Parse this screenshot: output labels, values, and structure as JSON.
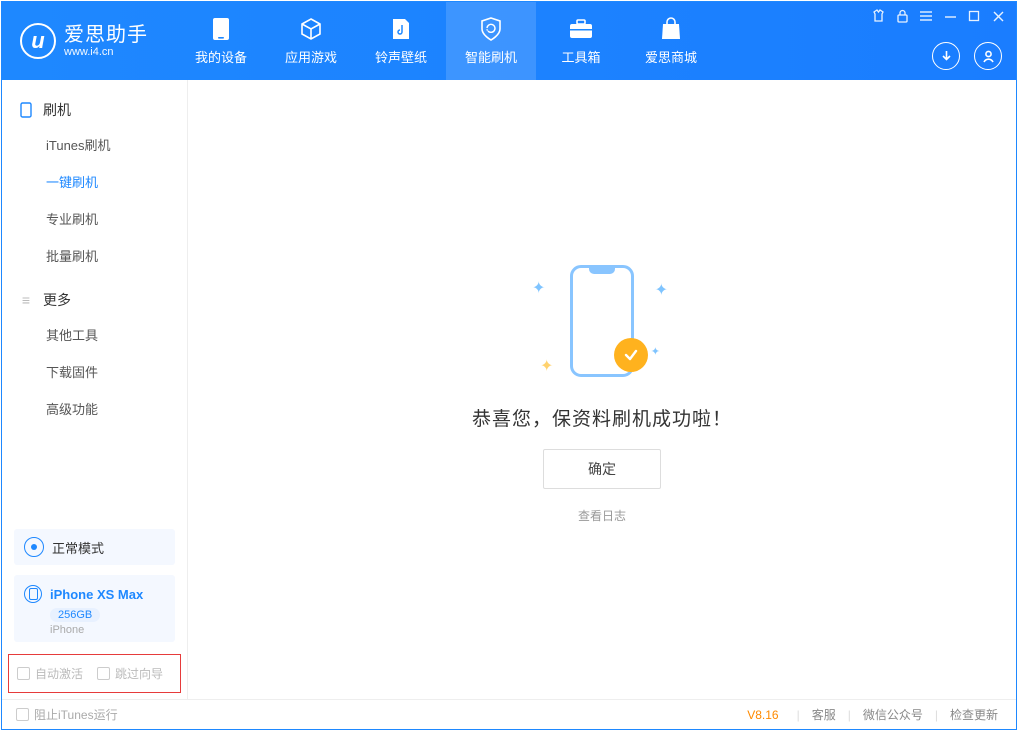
{
  "app": {
    "title": "爱思助手",
    "subtitle": "www.i4.cn"
  },
  "nav": {
    "tabs": [
      {
        "label": "我的设备"
      },
      {
        "label": "应用游戏"
      },
      {
        "label": "铃声壁纸"
      },
      {
        "label": "智能刷机"
      },
      {
        "label": "工具箱"
      },
      {
        "label": "爱思商城"
      }
    ]
  },
  "sidebar": {
    "section_flash": "刷机",
    "flash_items": [
      {
        "label": "iTunes刷机"
      },
      {
        "label": "一键刷机"
      },
      {
        "label": "专业刷机"
      },
      {
        "label": "批量刷机"
      }
    ],
    "section_more": "更多",
    "more_items": [
      {
        "label": "其他工具"
      },
      {
        "label": "下载固件"
      },
      {
        "label": "高级功能"
      }
    ],
    "mode": "正常模式",
    "device": {
      "name": "iPhone XS Max",
      "capacity": "256GB",
      "type": "iPhone"
    },
    "opt_auto_activate": "自动激活",
    "opt_skip_guide": "跳过向导"
  },
  "main": {
    "success_msg": "恭喜您，保资料刷机成功啦！",
    "ok_btn": "确定",
    "log_link": "查看日志"
  },
  "footer": {
    "block_itunes": "阻止iTunes运行",
    "version": "V8.16",
    "links": [
      {
        "label": "客服"
      },
      {
        "label": "微信公众号"
      },
      {
        "label": "检查更新"
      }
    ]
  }
}
